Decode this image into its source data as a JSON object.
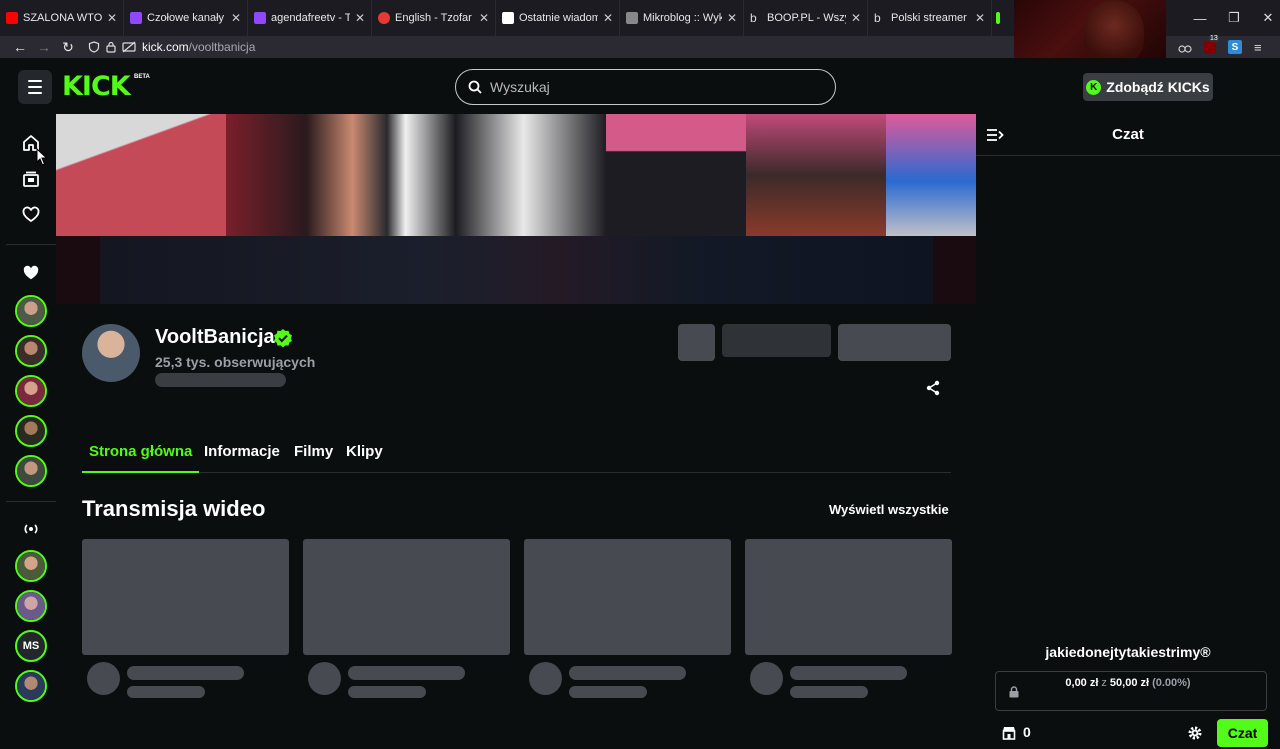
{
  "browser": {
    "tabs": [
      {
        "label": "SZALONA WTORKOW",
        "color": "#ff0000"
      },
      {
        "label": "Czołowe kanały - Tw",
        "color": "#9146ff"
      },
      {
        "label": "agendafreetv - Twitc",
        "color": "#9146ff"
      },
      {
        "label": "English - Tzofar - Re",
        "color": "#e53935"
      },
      {
        "label": "Ostatnie wiadomośc",
        "color": "#ffffff"
      },
      {
        "label": "Mikroblog :: Wykop.",
        "color": "#888888"
      },
      {
        "label": "BOOP.PL - Wszystko",
        "color": "#dddddd"
      },
      {
        "label": "Polski streamer Vool",
        "color": "#dddddd"
      }
    ],
    "url_host": "kick.com",
    "url_path": "/vooltbanicja",
    "ext_badge": "13"
  },
  "header": {
    "logo": "KICK",
    "logo_badge": "BETA",
    "search_placeholder": "Wyszukaj",
    "kicks_button": "Zdobądź KICKs"
  },
  "channel": {
    "name": "VooltBanicja",
    "followers": "25,3 tys. obserwujących"
  },
  "tabs": [
    "Strona główna",
    "Informacje",
    "Filmy",
    "Klipy"
  ],
  "section": {
    "title": "Transmisja wideo",
    "see_all": "Wyświetl wszystkie"
  },
  "sidebar": {
    "followed_avatars": 5,
    "recommended_label": "MS"
  },
  "chat": {
    "title": "Czat",
    "goal_title": "jakiedonejtytakiestrimy®",
    "goal_current": "0,00 zł",
    "goal_sep": "z",
    "goal_target": "50,00 zł",
    "goal_percent": "(0.00%)",
    "kick_count": "0",
    "send_button": "Czat"
  },
  "colors": {
    "accent": "#53fc18",
    "background": "#0b0e0f",
    "skeleton": "#474a51"
  }
}
